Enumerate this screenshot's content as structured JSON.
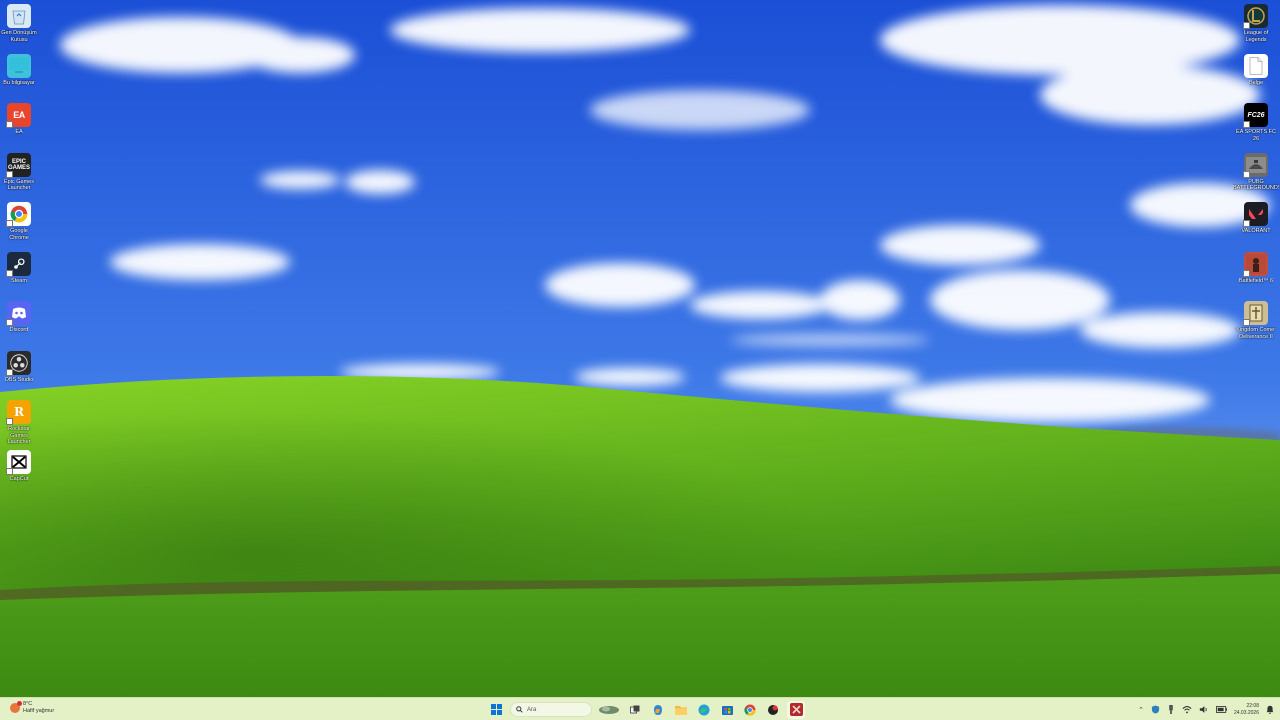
{
  "desktop": {
    "left_icons": [
      {
        "name": "recycle-bin-icon",
        "label": "Geri Dönüşüm Kutusu",
        "color": "#d9eaf7"
      },
      {
        "name": "this-pc-icon",
        "label": "Bu bilgisayar",
        "color": "#3fc2d9"
      },
      {
        "name": "ea-icon",
        "label": "EA",
        "color": "#e8452c"
      },
      {
        "name": "epic-games-icon",
        "label": "Epic Games Launcher",
        "color": "#222222"
      },
      {
        "name": "chrome-icon",
        "label": "Google Chrome",
        "color": "#ffffff"
      },
      {
        "name": "steam-icon",
        "label": "Steam",
        "color": "#1b2a3e"
      },
      {
        "name": "discord-icon",
        "label": "Discord",
        "color": "#5865f2"
      },
      {
        "name": "obs-studio-icon",
        "label": "OBS Studio",
        "color": "#2b2b2b"
      },
      {
        "name": "rockstar-games-icon",
        "label": "Rockstar Games Launcher",
        "color": "#f5a300"
      },
      {
        "name": "capcut-icon",
        "label": "CapCut",
        "color": "#ffffff"
      }
    ],
    "right_icons": [
      {
        "name": "league-of-legends-icon",
        "label": "League of Legends",
        "color": "#1a2a33"
      },
      {
        "name": "blank-file-icon",
        "label": "Belge",
        "color": "#ffffff"
      },
      {
        "name": "ea-sports-fc-icon",
        "label": "EA SPORTS FC 26",
        "color": "#000000"
      },
      {
        "name": "pubg-icon",
        "label": "PUBG BATTLEGROUNDS",
        "color": "#6b6b6b"
      },
      {
        "name": "valorant-icon",
        "label": "VALORANT",
        "color": "#1c1c24"
      },
      {
        "name": "battlefield-icon",
        "label": "Battlefield™ 6",
        "color": "#c94b3a"
      },
      {
        "name": "kingdom-come-icon",
        "label": "Kingdom Come: Deliverance II",
        "color": "#cdbd92"
      }
    ]
  },
  "taskbar": {
    "weather_temp": "8°C",
    "weather_desc": "Hafif yağmur",
    "search_placeholder": "Ara",
    "time": "22:08",
    "date": "24.03.2026",
    "pinned": [
      {
        "name": "start-button-icon",
        "active": false
      },
      {
        "name": "search-box",
        "active": false
      },
      {
        "name": "widgets-icon",
        "active": false
      },
      {
        "name": "task-view-icon",
        "active": false
      },
      {
        "name": "copilot-icon",
        "active": false
      },
      {
        "name": "file-explorer-icon",
        "active": false
      },
      {
        "name": "edge-icon",
        "active": false
      },
      {
        "name": "microsoft-store-icon",
        "active": false
      },
      {
        "name": "chrome-taskbar-icon",
        "active": false
      },
      {
        "name": "app-red-icon",
        "active": false
      },
      {
        "name": "app-active-icon",
        "active": true
      }
    ],
    "tray_icons": [
      "chevron-up-icon",
      "shield-tray-icon",
      "usb-tray-icon",
      "wifi-icon",
      "volume-icon",
      "battery-icon"
    ]
  },
  "colors": {
    "sky_top": "#1e55d9",
    "sky_bottom": "#8fb7f2",
    "hill_light": "#7fcd22",
    "hill_dark": "#2f7d12",
    "taskbar": "#e4f0c6"
  }
}
